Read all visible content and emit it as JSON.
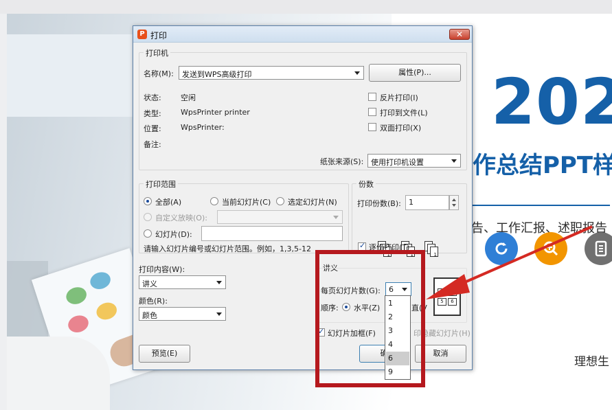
{
  "dialog": {
    "title": "打印",
    "close_glyph": "✕",
    "app_icon_glyph": "P",
    "printer_group": {
      "label": "打印机",
      "name_label": "名称(M):",
      "name_value": "发送到WPS高级打印",
      "properties_button": "属性(P)...",
      "status_label": "状态:",
      "status_value": "空闲",
      "type_label": "类型:",
      "type_value": "WpsPrinter printer",
      "location_label": "位置:",
      "location_value": "WpsPrinter:",
      "comment_label": "备注:",
      "reverse_print": "反片打印(I)",
      "print_to_file": "打印到文件(L)",
      "duplex": "双面打印(X)",
      "paper_source_label": "纸张来源(S):",
      "paper_source_value": "使用打印机设置"
    },
    "range_group": {
      "label": "打印范围",
      "all": "全部(A)",
      "current_slide": "当前幻灯片(C)",
      "selection": "选定幻灯片(N)",
      "custom_show": "自定义放映(O):",
      "slides": "幻灯片(D):",
      "hint": "请输入幻灯片编号或幻灯片范围。例如，1,3,5-12"
    },
    "copies_group": {
      "label": "份数",
      "copies_label": "打印份数(B):",
      "copies_value": "1",
      "collate": "逐份打印(T)",
      "collate_icons": [
        "3",
        "2",
        "1",
        "3",
        "2",
        "1",
        "3",
        "2",
        "1"
      ]
    },
    "content": {
      "print_what_label": "打印内容(W):",
      "print_what_value": "讲义",
      "color_label": "颜色(R):",
      "color_value": "颜色"
    },
    "handout": {
      "label": "讲义",
      "slides_per_page_label": "每页幻灯片数(G):",
      "slides_per_page_value": "6",
      "order_label": "顺序:",
      "horizontal": "水平(Z)",
      "vertical_partial": "直(V",
      "frame_slides": "幻灯片加框(F)",
      "print_hidden_partial": "印隐藏幻灯片(H)",
      "preview_numbers": [
        "3",
        "5",
        "4",
        "6"
      ]
    },
    "dropdown_options": [
      "1",
      "2",
      "3",
      "4",
      "6",
      "9"
    ],
    "dropdown_selected": "6",
    "preview_button": "预览(E)",
    "ok_button_partial": "确",
    "cancel_button": "取消"
  },
  "slide": {
    "year": "202",
    "title": "作总结PPT样",
    "subtitle": "告、工作汇报、述职报告",
    "tagline": "理想生",
    "icons": [
      "refresh-icon",
      "search-icon",
      "document-icon"
    ],
    "colors": {
      "brand_blue": "#1560a8",
      "icon_blue": "#2f7fd6",
      "icon_orange": "#f29500",
      "icon_grey": "#707070",
      "annotation_red": "#b5191e"
    }
  }
}
